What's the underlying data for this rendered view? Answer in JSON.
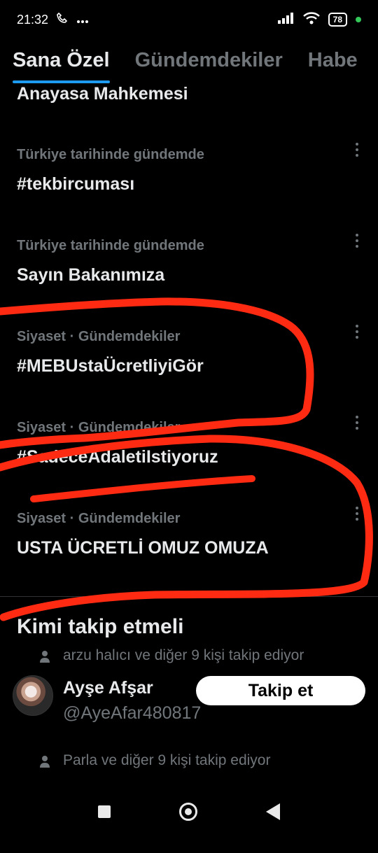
{
  "status_bar": {
    "time": "21:32",
    "battery": "78",
    "icons": [
      "phone-icon",
      "more-icon",
      "signal-icon",
      "wifi-icon",
      "battery-icon",
      "active-dot-icon"
    ]
  },
  "tabs": [
    {
      "label": "Sana Özel",
      "active": true
    },
    {
      "label": "Gündemdekiler",
      "active": false
    },
    {
      "label": "Habe",
      "active": false
    }
  ],
  "trends": {
    "top_partial": "Anayasa Mahkemesi",
    "items": [
      {
        "meta": "Türkiye tarihinde gündemde",
        "title": "#tekbircuması"
      },
      {
        "meta": "Türkiye tarihinde gündemde",
        "title": "Sayın Bakanımıza"
      },
      {
        "meta": "Siyaset · Gündemdekiler",
        "title": "#MEBUstaÜcretliyiGör"
      },
      {
        "meta": "Siyaset · Gündemdekiler",
        "title": "#SadeceAdaletiIstiyoruz"
      },
      {
        "meta": "Siyaset · Gündemdekiler",
        "title": "USTA ÜCRETLİ OMUZ OMUZA"
      }
    ]
  },
  "who_to_follow": {
    "title": "Kimi takip etmeli",
    "accounts": [
      {
        "social": "arzu halıcı ve diğer 9 kişi takip ediyor",
        "name": "Ayşe Afşar",
        "handle": "@AyeAfar480817",
        "button": "Takip et"
      },
      {
        "social": "Parla ve diğer 9 kişi takip ediyor",
        "name": "",
        "handle": "",
        "button": ""
      }
    ]
  },
  "annotation": {
    "color": "#ff2a12"
  },
  "colors": {
    "background": "#000000",
    "accent": "#1d9bf0",
    "muted": "#71767b",
    "text": "#e7e9ea"
  }
}
